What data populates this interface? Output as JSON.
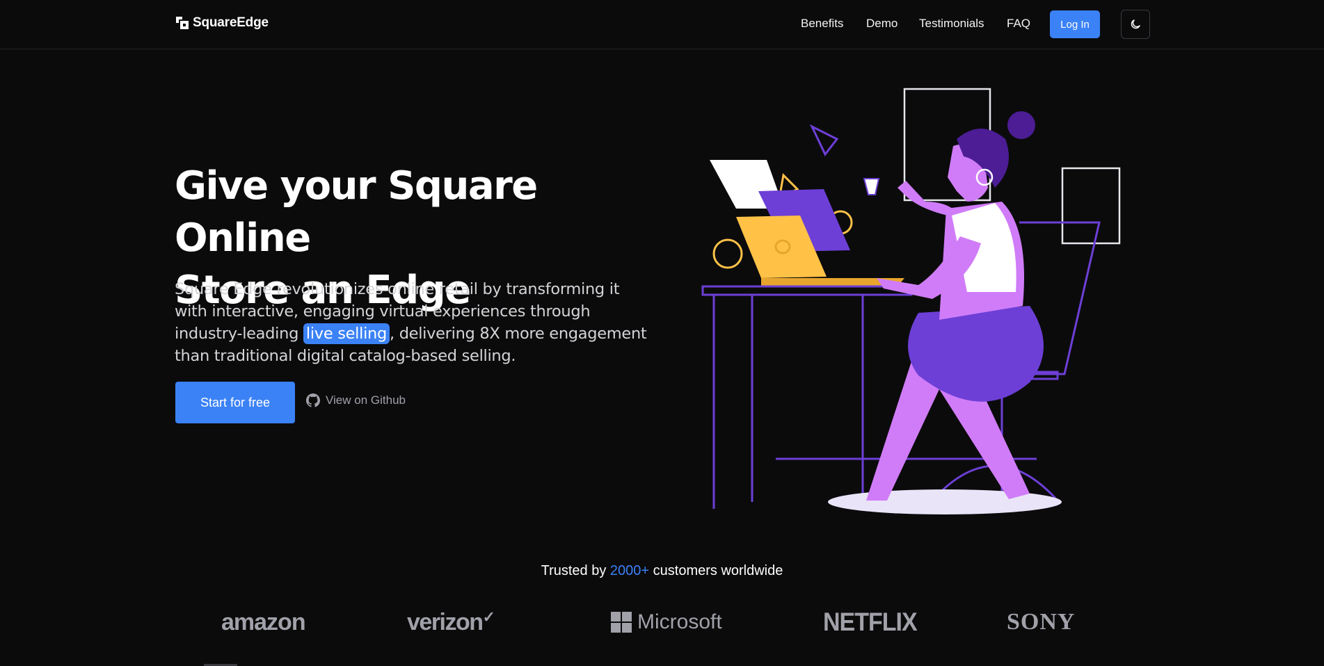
{
  "header": {
    "logo_text": "SquareEdge",
    "nav": [
      {
        "label": "Benefits"
      },
      {
        "label": "Demo"
      },
      {
        "label": "Testimonials"
      },
      {
        "label": "FAQ"
      }
    ],
    "login_label": "Log In",
    "theme_toggle_icon": "moon-icon"
  },
  "hero": {
    "title_line1": "Give your Square Online",
    "title_line2": "Store an Edge",
    "desc_before": "Square Edge revolutionizes online retail by transforming it with interactive, engaging virtual experiences through industry-leading ",
    "desc_highlight": "live selling",
    "desc_after": ", delivering 8X more engagement than traditional digital catalog-based selling.",
    "cta_primary": "Start for free",
    "cta_secondary": "View on Github",
    "cta_secondary_icon": "github-icon"
  },
  "trusted": {
    "prefix": "Trusted by ",
    "count": "2000+",
    "suffix": " customers worldwide"
  },
  "brands": [
    {
      "name": "amazon"
    },
    {
      "name": "verizon"
    },
    {
      "name": "Microsoft"
    },
    {
      "name": "NETFLIX"
    },
    {
      "name": "SONY"
    }
  ],
  "colors": {
    "background": "#0b0b0c",
    "accent": "#3b82f6",
    "illustration_purple": "#6d3fd6",
    "illustration_pink": "#d07cf8",
    "illustration_yellow": "#ffc247"
  }
}
